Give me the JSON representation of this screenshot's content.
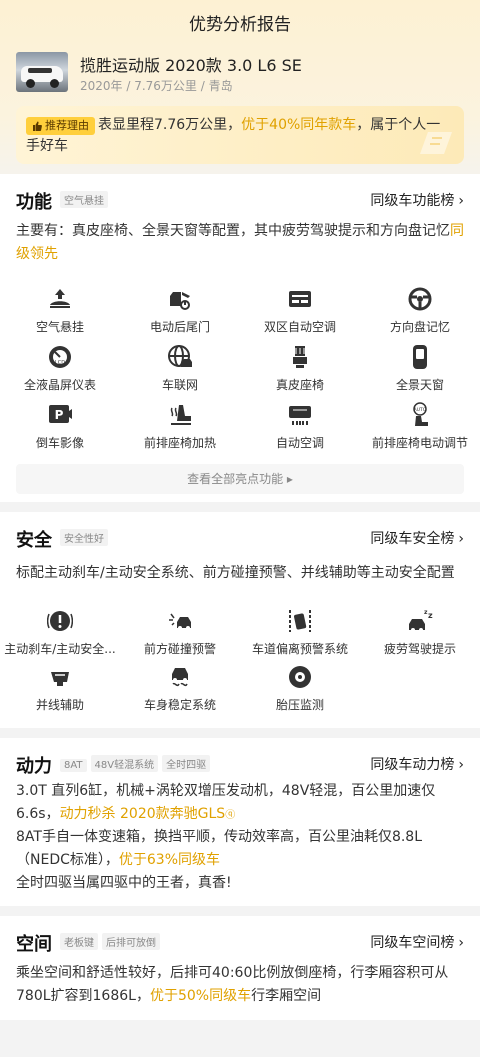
{
  "header": {
    "title": "优势分析报告"
  },
  "car": {
    "name": "揽胜运动版 2020款 3.0 L6 SE",
    "meta": "2020年 / 7.76万公里 / 青岛"
  },
  "reason": {
    "badge": "推荐理由",
    "text_a": "表显里程7.76万公里，",
    "text_hl": "优于40%同年款车",
    "text_b": "，属于个人一手好车"
  },
  "features": {
    "title": "功能",
    "tag": "空气悬挂",
    "rank": "同级车功能榜",
    "desc_a": "主要有：真皮座椅、全景天窗等配置，其中疲劳驾驶提示和方向盘记忆",
    "desc_hl": "同级领先",
    "items": [
      {
        "label": "空气悬挂",
        "icon": "air-suspension-icon"
      },
      {
        "label": "电动后尾门",
        "icon": "power-tailgate-icon"
      },
      {
        "label": "双区自动空调",
        "icon": "dual-zone-ac-icon"
      },
      {
        "label": "方向盘记忆",
        "icon": "steering-memory-icon"
      },
      {
        "label": "全液晶屏仪表",
        "icon": "lcd-cluster-icon"
      },
      {
        "label": "车联网",
        "icon": "connected-car-icon"
      },
      {
        "label": "真皮座椅",
        "icon": "leather-seat-icon"
      },
      {
        "label": "全景天窗",
        "icon": "panoramic-sunroof-icon"
      },
      {
        "label": "倒车影像",
        "icon": "reverse-camera-icon"
      },
      {
        "label": "前排座椅加热",
        "icon": "seat-heating-icon"
      },
      {
        "label": "自动空调",
        "icon": "auto-ac-icon"
      },
      {
        "label": "前排座椅电动调节",
        "icon": "power-seat-icon"
      }
    ],
    "viewall": "查看全部亮点功能"
  },
  "safety": {
    "title": "安全",
    "tag": "安全性好",
    "rank": "同级车安全榜",
    "desc": "标配主动刹车/主动安全系统、前方碰撞预警、并线辅助等主动安全配置",
    "items": [
      {
        "label": "主动刹车/主动安全...",
        "icon": "active-brake-icon"
      },
      {
        "label": "前方碰撞预警",
        "icon": "collision-warning-icon"
      },
      {
        "label": "车道偏离预警系统",
        "icon": "lane-departure-icon"
      },
      {
        "label": "疲劳驾驶提示",
        "icon": "fatigue-alert-icon"
      },
      {
        "label": "并线辅助",
        "icon": "blind-spot-icon"
      },
      {
        "label": "车身稳定系统",
        "icon": "stability-control-icon"
      },
      {
        "label": "胎压监测",
        "icon": "tire-pressure-icon"
      }
    ]
  },
  "power": {
    "title": "动力",
    "tags": [
      "8AT",
      "48V轻混系统",
      "全时四驱"
    ],
    "rank": "同级车动力榜",
    "p1_a": "3.0T 直列6缸，机械+涡轮双增压发动机，48V轻混，百公里加速仅6.6s，",
    "p1_hl": "动力秒杀 2020款奔驰GLS",
    "p2_a": "8AT手自一体变速箱，换挡平顺，传动效率高，百公里油耗仅8.8L（NEDC标准），",
    "p2_hl": "优于63%同级车",
    "p3": "全时四驱当属四驱中的王者，真香!"
  },
  "space": {
    "title": "空间",
    "tags": [
      "老板键",
      "后排可放倒"
    ],
    "rank": "同级车空间榜",
    "desc_a": "乘坐空间和舒适性较好，后排可40:60比例放倒座椅，行李厢容积可从780L扩容到1686L，",
    "desc_hl": "优于50%同级车",
    "desc_b": "行李厢空间"
  },
  "colors": {
    "accent": "#e0a100",
    "badge": "#ffcf3c"
  }
}
